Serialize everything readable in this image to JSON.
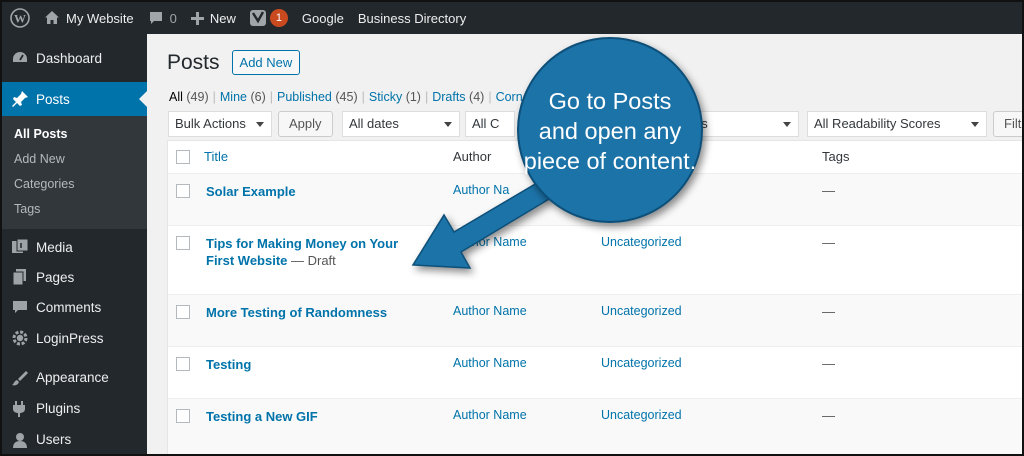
{
  "admin_bar": {
    "site_name": "My Website",
    "comments_count": "0",
    "new_label": "New",
    "yoast_badge": "1",
    "google_label": "Google",
    "directory_label": "Business Directory"
  },
  "sidebar": {
    "items": [
      {
        "label": "Dashboard",
        "icon": "dashboard-icon"
      },
      {
        "label": "Posts",
        "icon": "pin-icon",
        "current": true
      },
      {
        "label": "Media",
        "icon": "media-icon"
      },
      {
        "label": "Pages",
        "icon": "pages-icon"
      },
      {
        "label": "Comments",
        "icon": "comments-icon"
      },
      {
        "label": "LoginPress",
        "icon": "gear-icon"
      },
      {
        "label": "Appearance",
        "icon": "brush-icon"
      },
      {
        "label": "Plugins",
        "icon": "plug-icon"
      },
      {
        "label": "Users",
        "icon": "user-icon"
      }
    ],
    "submenu": [
      "All Posts",
      "Add New",
      "Categories",
      "Tags"
    ]
  },
  "main": {
    "title": "Posts",
    "add_new": "Add New",
    "filters": [
      {
        "label": "All",
        "count": "(49)"
      },
      {
        "label": "Mine",
        "count": "(6)"
      },
      {
        "label": "Published",
        "count": "(45)"
      },
      {
        "label": "Sticky",
        "count": "(1)"
      },
      {
        "label": "Drafts",
        "count": "(4)"
      },
      {
        "label": "Corn",
        "count": ""
      }
    ],
    "bulk_actions": "Bulk Actions",
    "apply": "Apply",
    "all_dates": "All dates",
    "all_categories": "All C",
    "seo_scores": "es",
    "readability": "All Readability Scores",
    "filter_button": "Filte"
  },
  "table": {
    "headers": {
      "title": "Title",
      "author": "Author",
      "tags": "Tags"
    },
    "rows": [
      {
        "title": "Solar Example",
        "state": "",
        "author": "Author Na",
        "category": "",
        "tags": "—"
      },
      {
        "title": "Tips for Making Money on Your First Website",
        "state": " — Draft",
        "author": "Author Name",
        "category": "Uncategorized",
        "tags": "—"
      },
      {
        "title": "More Testing of Randomness",
        "state": "",
        "author": "Author Name",
        "category": "Uncategorized",
        "tags": "—"
      },
      {
        "title": "Testing",
        "state": "",
        "author": "Author Name",
        "category": "Uncategorized",
        "tags": "—"
      },
      {
        "title": "Testing a New GIF",
        "state": "",
        "author": "Author Name",
        "category": "Uncategorized",
        "tags": "—"
      }
    ]
  },
  "callout": {
    "line1": "Go to Posts",
    "line2": "and open any",
    "line3": "piece of content."
  },
  "colors": {
    "admin_dark": "#23282d",
    "accent_blue": "#0073aa",
    "callout_blue": "#1a73a8",
    "badge_orange": "#ca4a1f"
  }
}
